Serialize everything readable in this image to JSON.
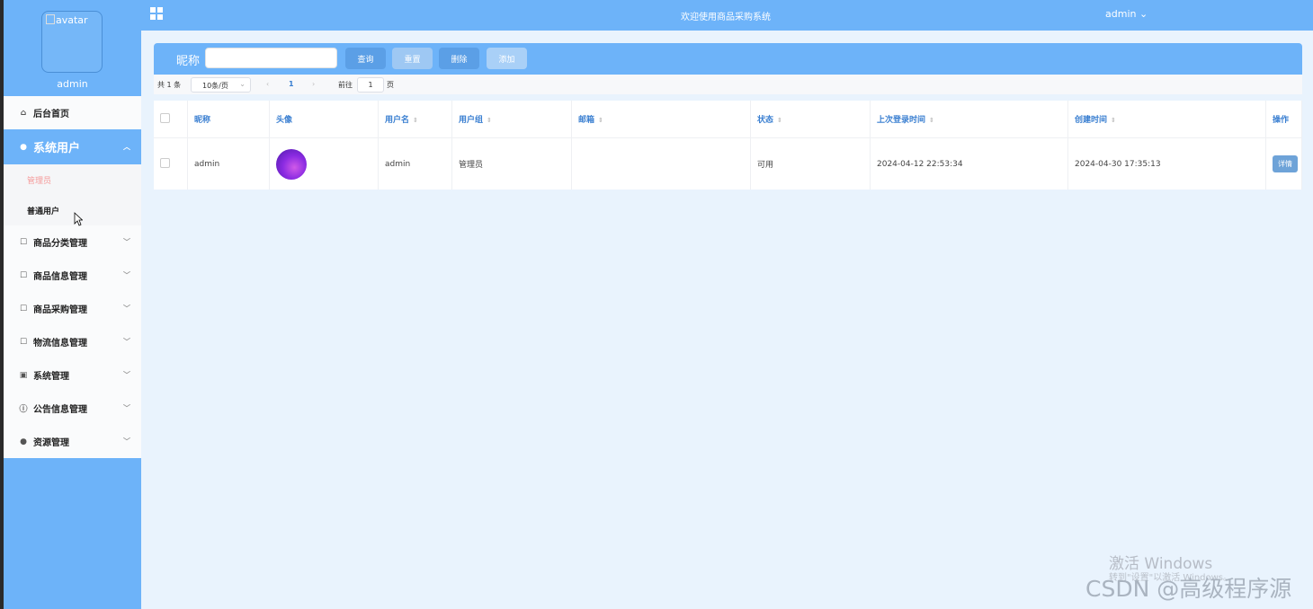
{
  "sidebar": {
    "avatar_alt": "avatar",
    "username": "admin",
    "menu": {
      "home": "后台首页",
      "system_users": "系统用户",
      "sub_admin": "管理员",
      "sub_normal": "普通用户",
      "category": "商品分类管理",
      "product_info": "商品信息管理",
      "purchase": "商品采购管理",
      "logistics": "物流信息管理",
      "system": "系统管理",
      "notice": "公告信息管理",
      "resource": "资源管理"
    }
  },
  "header": {
    "title": "欢迎使用商品采购系统",
    "user": "admin ⌄"
  },
  "search": {
    "nickname_label": "昵称",
    "nickname_value": "",
    "buttons": {
      "query": "查询",
      "reset": "重置",
      "delete": "删除",
      "add": "添加"
    }
  },
  "pagination": {
    "total": "共 1 条",
    "page_size": "10条/页",
    "current_page": "1",
    "goto_label": "前往",
    "goto_value": "1",
    "page_suffix": "页"
  },
  "table": {
    "headers": {
      "nickname": "昵称",
      "avatar": "头像",
      "username": "用户名",
      "usergroup": "用户组",
      "email": "邮箱",
      "status": "状态",
      "last_login": "上次登录时间",
      "created": "创建时间",
      "actions": "操作"
    },
    "rows": [
      {
        "nickname": "admin",
        "username": "admin",
        "usergroup": "管理员",
        "email": "",
        "status": "可用",
        "last_login": "2024-04-12 22:53:34",
        "created": "2024-04-30 17:35:13",
        "action": "详情"
      }
    ]
  },
  "watermark": {
    "activate": "激活 Windows",
    "activate_sub": "转到\"设置\"以激活 Windows。",
    "csdn": "CSDN @高级程序源"
  },
  "colors": {
    "primary": "#6db3f9",
    "link": "#3a7fd1",
    "active_sub": "#f59a9a"
  }
}
